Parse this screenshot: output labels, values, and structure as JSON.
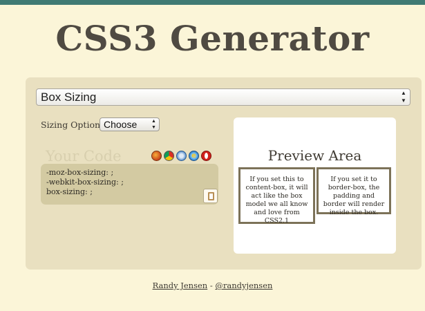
{
  "header": {
    "title": "CSS3 Generator"
  },
  "generator": {
    "selected_property": "Box Sizing",
    "option_label": "Sizing Option:",
    "option_value": "Choose"
  },
  "code": {
    "title": "Your Code",
    "browser_icons": [
      "firefox-icon",
      "chrome-icon",
      "safari-icon",
      "ie-icon",
      "opera-icon"
    ],
    "lines": [
      "-moz-box-sizing: ;",
      "-webkit-box-sizing: ;",
      "box-sizing: ;"
    ],
    "copy_icon": "clipboard-icon"
  },
  "preview": {
    "title": "Preview Area",
    "box_a": "If you set this to content-box, it will act like the box model we all know and love from CSS2.1",
    "box_b": "If you set it to border-box, the padding and border will render inside the box."
  },
  "footer": {
    "author": "Randy Jensen",
    "separator": " - ",
    "handle": "@randyjensen"
  },
  "colors": {
    "topbar": "#3f7a73",
    "background": "#fbf5d8",
    "panel": "#e9e0c0",
    "codebox": "#d3caa2",
    "demo_border": "#7c7258"
  }
}
